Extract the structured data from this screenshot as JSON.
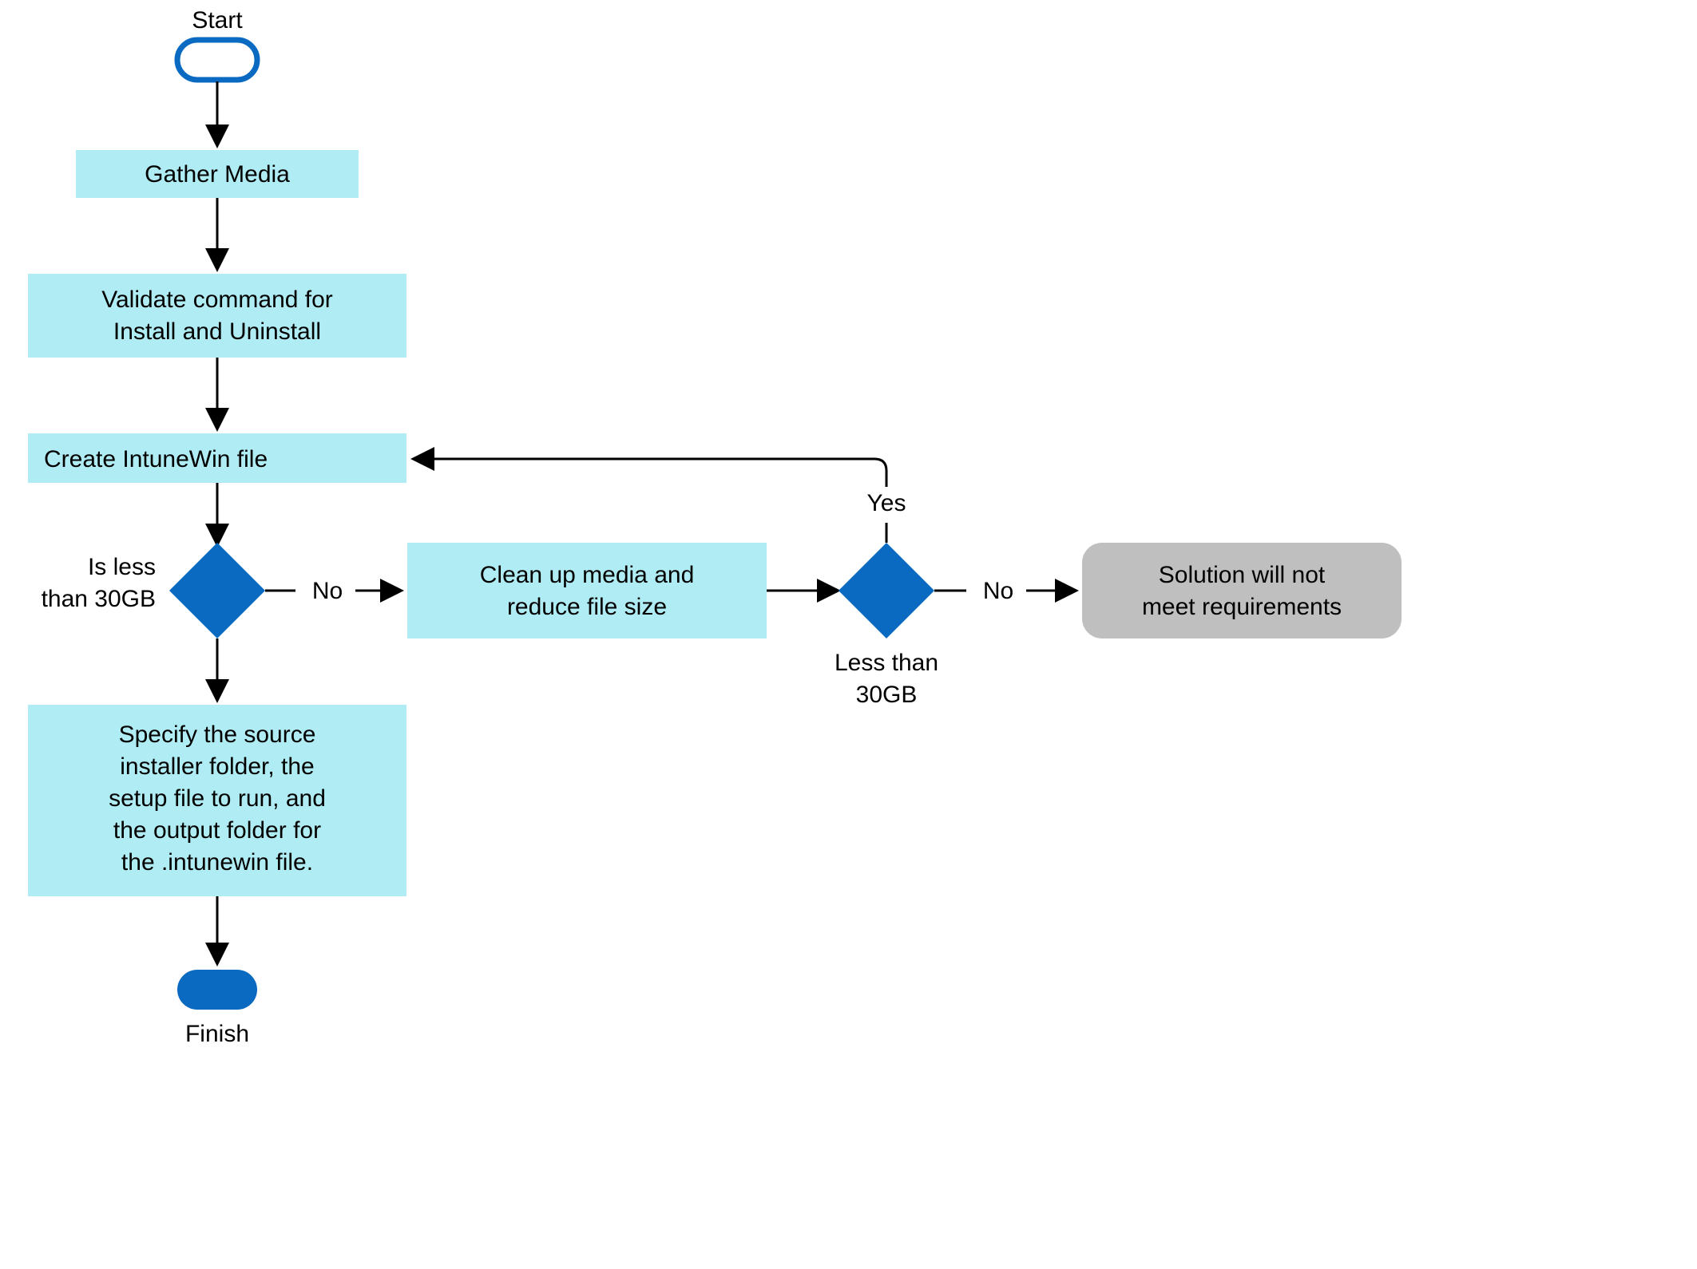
{
  "start": "Start",
  "finish": "Finish",
  "gather": "Gather Media",
  "validate1": "Validate command for",
  "validate2": "Install and Uninstall",
  "create": "Create IntuneWin file",
  "isless1": "Is less",
  "isless2": "than 30GB",
  "no1": "No",
  "clean1": "Clean up media and",
  "clean2": "reduce file size",
  "less1": "Less than",
  "less2": "30GB",
  "yes": "Yes",
  "no2": "No",
  "solution1": "Solution will not",
  "solution2": "meet requirements",
  "specify1": "Specify the source",
  "specify2": "installer folder, the",
  "specify3": "setup file to run, and",
  "specify4": "the output folder for",
  "specify5": "the .intunewin file."
}
